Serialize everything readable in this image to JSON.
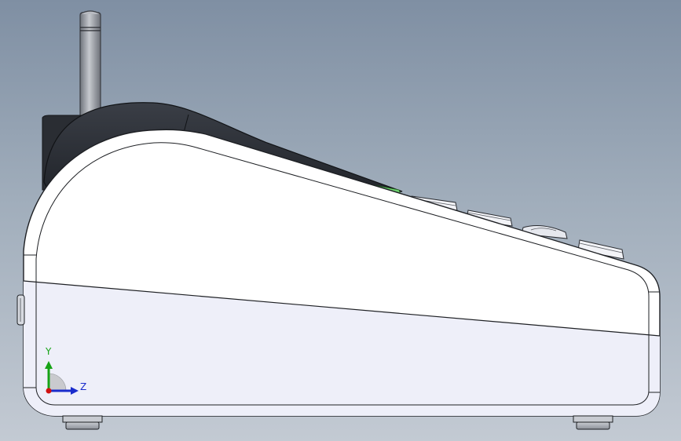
{
  "viewport": {
    "background_top": "#7f8fa3",
    "background_bottom": "#c3cad3"
  },
  "triad": {
    "y_label": "Y",
    "z_label": "Z",
    "y_color": "#16a316",
    "z_color": "#1a2ccc",
    "origin_color": "#d01010"
  },
  "model": {
    "body_color": "#ffffff",
    "lower_shell_color": "#eeeff9",
    "top_cover_color": "#2c2f36",
    "antenna_color": "#9a9ea6",
    "accent_color": "#6fd16f"
  },
  "icons": {
    "antenna": "antenna-icon",
    "keys": "key-button-icon",
    "foot": "rubber-foot-icon"
  }
}
